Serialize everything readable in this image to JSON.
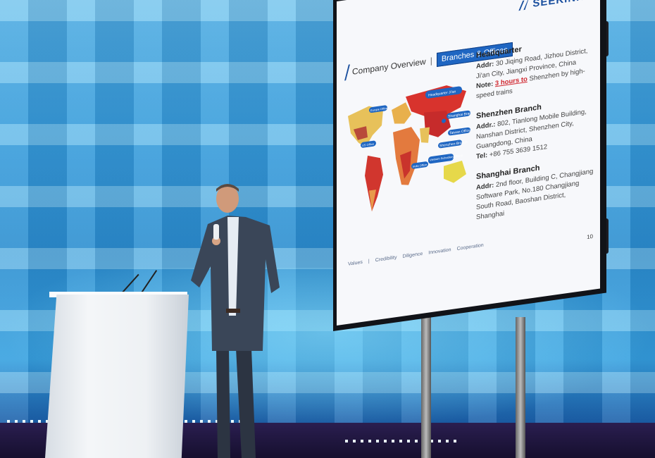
{
  "slide": {
    "logo_text": "SEEKINK",
    "title": "Company Overview",
    "title_separator": "|",
    "tag": "Branches & Offices",
    "map_labels": {
      "headquarter": "Headquarter Ji'an",
      "shanghai": "Shanghai Branch",
      "shenzhen": "Shenzhen Branch",
      "taiwan": "Taiwan Office",
      "india": "India Office",
      "vietnam": "Vietnam Subsidiary (Plant)",
      "europe": "Europe Office",
      "us": "US Office"
    },
    "offices": [
      {
        "name": "Headquarter",
        "addr_label": "Addr:",
        "addr": "30 Jiqing Road, Jizhou District, Ji'an City, Jiangxi Province, China",
        "note_label": "Note:",
        "note_highlight": "3 hours to",
        "note_rest": "Shenzhen by high-speed trains"
      },
      {
        "name": "Shenzhen Branch",
        "addr_label": "Addr.:",
        "addr": "802, Tianlong Mobile Building, Nanshan District, Shenzhen City, Guangdong, China",
        "tel_label": "Tel:",
        "tel": "+86 755 3639 1512"
      },
      {
        "name": "Shanghai Branch",
        "addr_label": "Addr:",
        "addr": "2nd floor, Building C, Changjiang Software Park, No.180 Changjiang South Road, Baoshan District, Shanghai"
      }
    ],
    "footer": [
      "Values",
      "|",
      "Credibility",
      "Diligence",
      "Innovation",
      "Cooperation"
    ],
    "page_number": "10"
  },
  "colors": {
    "wall": "#3da4e0",
    "slide_accent": "#1f66c2",
    "highlight": "#d0262e",
    "podium": "#eef1f4",
    "suit": "#3a4658"
  }
}
